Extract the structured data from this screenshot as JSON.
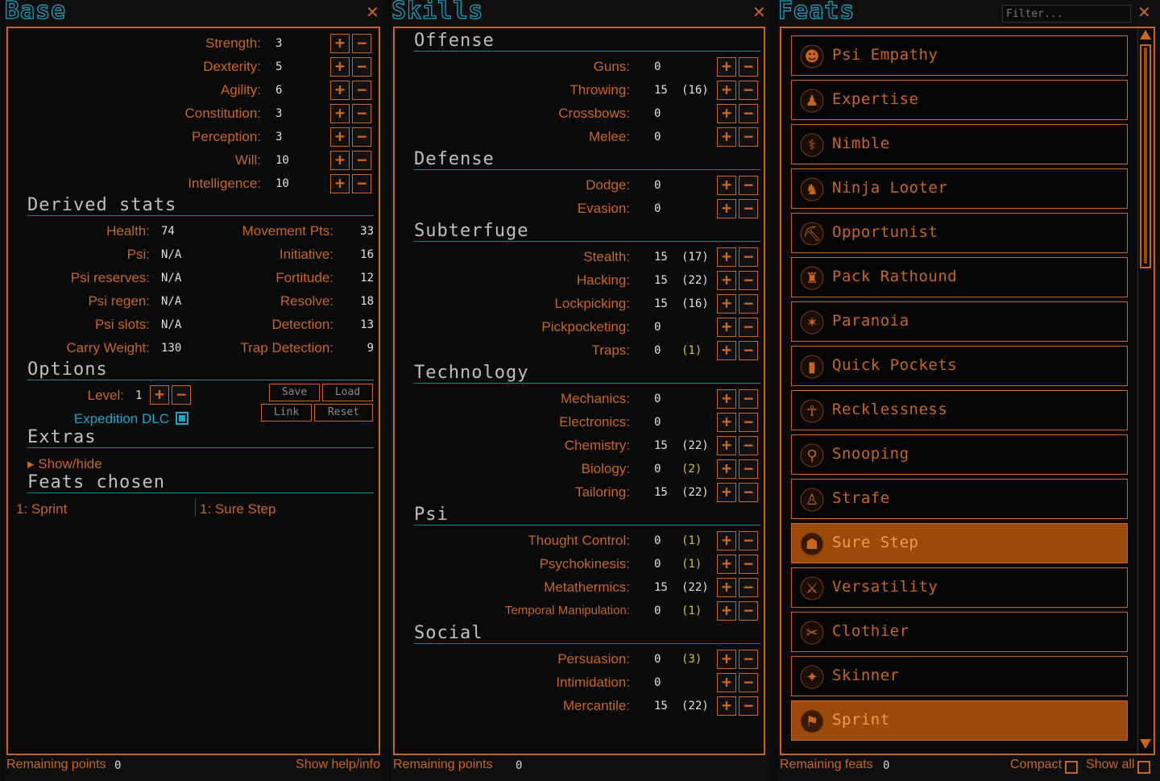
{
  "base": {
    "title": "Base",
    "close": "✕",
    "attributes": [
      {
        "label": "Strength:",
        "value": "3"
      },
      {
        "label": "Dexterity:",
        "value": "5"
      },
      {
        "label": "Agility:",
        "value": "6"
      },
      {
        "label": "Constitution:",
        "value": "3"
      },
      {
        "label": "Perception:",
        "value": "3"
      },
      {
        "label": "Will:",
        "value": "10"
      },
      {
        "label": "Intelligence:",
        "value": "10"
      }
    ],
    "derived_title": "Derived stats",
    "derived_left": [
      {
        "label": "Health:",
        "value": "74"
      },
      {
        "label": "Psi:",
        "value": "N/A"
      },
      {
        "label": "Psi reserves:",
        "value": "N/A"
      },
      {
        "label": "Psi regen:",
        "value": "N/A"
      },
      {
        "label": "Psi slots:",
        "value": "N/A"
      },
      {
        "label": "Carry Weight:",
        "value": "130"
      }
    ],
    "derived_right": [
      {
        "label": "Movement Pts:",
        "value": "33"
      },
      {
        "label": "Initiative:",
        "value": "16"
      },
      {
        "label": "Fortitude:",
        "value": "12"
      },
      {
        "label": "Resolve:",
        "value": "18"
      },
      {
        "label": "Detection:",
        "value": "13"
      },
      {
        "label": "Trap Detection:",
        "value": "9"
      }
    ],
    "options_title": "Options",
    "level_label": "Level:",
    "level_value": "1",
    "save": "Save",
    "load": "Load",
    "link": "Link",
    "reset": "Reset",
    "expedition_label": "Expedition DLC",
    "expedition_checked": true,
    "extras_title": "Extras",
    "show_hide": "▸ Show/hide",
    "feats_chosen_title": "Feats chosen",
    "feats_chosen": [
      "1: Sprint",
      "1: Sure Step"
    ],
    "footer_label": "Remaining points",
    "footer_value": "0",
    "help": "Show help/info"
  },
  "skills": {
    "title": "Skills",
    "close": "✕",
    "groups": [
      {
        "name": "Offense",
        "items": [
          {
            "label": "Guns:",
            "value": "0",
            "bonus": "",
            "bonus_yellow": false
          },
          {
            "label": "Throwing:",
            "value": "15",
            "bonus": "(16)",
            "bonus_yellow": false
          },
          {
            "label": "Crossbows:",
            "value": "0",
            "bonus": "",
            "bonus_yellow": false
          },
          {
            "label": "Melee:",
            "value": "0",
            "bonus": "",
            "bonus_yellow": false
          }
        ]
      },
      {
        "name": "Defense",
        "items": [
          {
            "label": "Dodge:",
            "value": "0",
            "bonus": "",
            "bonus_yellow": false
          },
          {
            "label": "Evasion:",
            "value": "0",
            "bonus": "",
            "bonus_yellow": false
          }
        ]
      },
      {
        "name": "Subterfuge",
        "items": [
          {
            "label": "Stealth:",
            "value": "15",
            "bonus": "(17)",
            "bonus_yellow": false
          },
          {
            "label": "Hacking:",
            "value": "15",
            "bonus": "(22)",
            "bonus_yellow": false
          },
          {
            "label": "Lockpicking:",
            "value": "15",
            "bonus": "(16)",
            "bonus_yellow": false
          },
          {
            "label": "Pickpocketing:",
            "value": "0",
            "bonus": "",
            "bonus_yellow": false
          },
          {
            "label": "Traps:",
            "value": "0",
            "bonus": "(1)",
            "bonus_yellow": true
          }
        ]
      },
      {
        "name": "Technology",
        "items": [
          {
            "label": "Mechanics:",
            "value": "0",
            "bonus": "",
            "bonus_yellow": false
          },
          {
            "label": "Electronics:",
            "value": "0",
            "bonus": "",
            "bonus_yellow": false
          },
          {
            "label": "Chemistry:",
            "value": "15",
            "bonus": "(22)",
            "bonus_yellow": false
          },
          {
            "label": "Biology:",
            "value": "0",
            "bonus": "(2)",
            "bonus_yellow": true
          },
          {
            "label": "Tailoring:",
            "value": "15",
            "bonus": "(22)",
            "bonus_yellow": false
          }
        ]
      },
      {
        "name": "Psi",
        "items": [
          {
            "label": "Thought Control:",
            "value": "0",
            "bonus": "(1)",
            "bonus_yellow": true
          },
          {
            "label": "Psychokinesis:",
            "value": "0",
            "bonus": "(1)",
            "bonus_yellow": true
          },
          {
            "label": "Metathermics:",
            "value": "15",
            "bonus": "(22)",
            "bonus_yellow": false
          },
          {
            "label": "Temporal Manipulation:",
            "value": "0",
            "bonus": "(1)",
            "bonus_yellow": true
          }
        ]
      },
      {
        "name": "Social",
        "items": [
          {
            "label": "Persuasion:",
            "value": "0",
            "bonus": "(3)",
            "bonus_yellow": true
          },
          {
            "label": "Intimidation:",
            "value": "0",
            "bonus": "",
            "bonus_yellow": false
          },
          {
            "label": "Mercantile:",
            "value": "15",
            "bonus": "(22)",
            "bonus_yellow": false
          }
        ]
      }
    ],
    "footer_label": "Remaining points",
    "footer_value": "0"
  },
  "feats": {
    "title": "Feats",
    "close": "✕",
    "filter_placeholder": "Filter...",
    "items": [
      {
        "name": "Psi Empathy",
        "icon": "psi-empathy-icon",
        "selected": false
      },
      {
        "name": "Expertise",
        "icon": "expertise-icon",
        "selected": false
      },
      {
        "name": "Nimble",
        "icon": "nimble-icon",
        "selected": false
      },
      {
        "name": "Ninja Looter",
        "icon": "ninja-looter-icon",
        "selected": false
      },
      {
        "name": "Opportunist",
        "icon": "opportunist-icon",
        "selected": false
      },
      {
        "name": "Pack Rathound",
        "icon": "pack-rathound-icon",
        "selected": false
      },
      {
        "name": "Paranoia",
        "icon": "paranoia-icon",
        "selected": false
      },
      {
        "name": "Quick Pockets",
        "icon": "quick-pockets-icon",
        "selected": false
      },
      {
        "name": "Recklessness",
        "icon": "recklessness-icon",
        "selected": false
      },
      {
        "name": "Snooping",
        "icon": "snooping-icon",
        "selected": false
      },
      {
        "name": "Strafe",
        "icon": "strafe-icon",
        "selected": false
      },
      {
        "name": "Sure Step",
        "icon": "sure-step-icon",
        "selected": true
      },
      {
        "name": "Versatility",
        "icon": "versatility-icon",
        "selected": false
      },
      {
        "name": "Clothier",
        "icon": "clothier-icon",
        "selected": false
      },
      {
        "name": "Skinner",
        "icon": "skinner-icon",
        "selected": false
      },
      {
        "name": "Sprint",
        "icon": "sprint-icon",
        "selected": true
      }
    ],
    "footer_label": "Remaining feats",
    "footer_value": "0",
    "compact": "Compact",
    "show_all": "Show all"
  },
  "colors": {
    "accent": "#c8661e",
    "title": "#1aa6c9",
    "selected": "#9b4a0c",
    "bonus": "#d7c21e"
  }
}
